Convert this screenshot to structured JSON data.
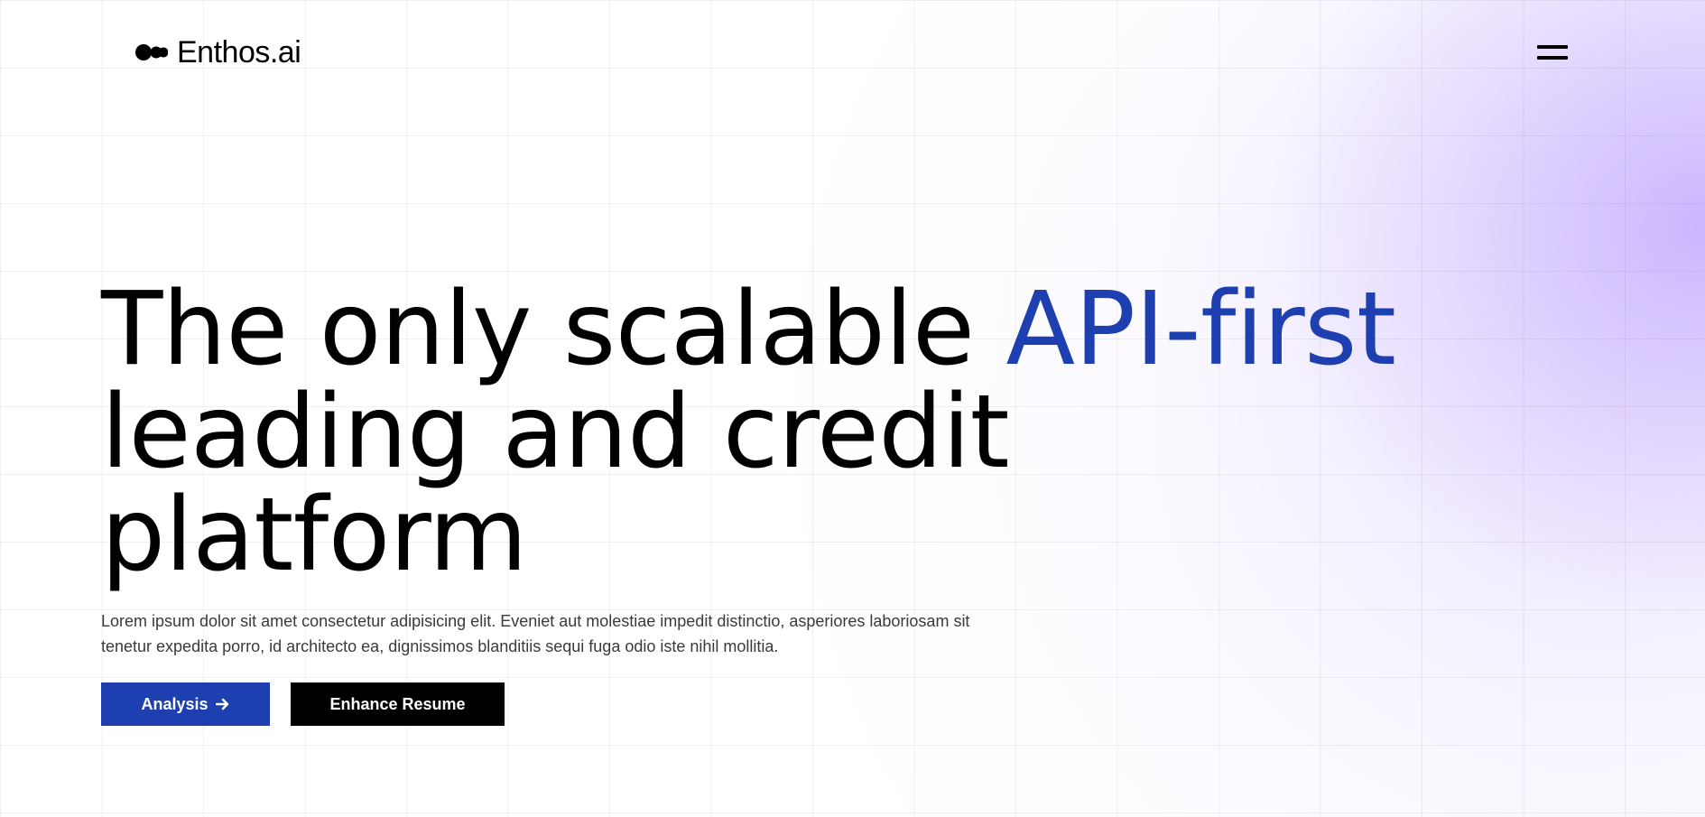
{
  "brand": {
    "name": "Enthos.ai",
    "logo_icon": "two-circles-logo-icon"
  },
  "header": {
    "menu_icon": "hamburger-menu-icon"
  },
  "hero": {
    "title_part1": "The only scalable ",
    "title_accent": "API-first",
    "title_part2": "leading and credit platform",
    "description": "Lorem ipsum dolor sit amet consectetur adipisicing elit. Eveniet aut molestiae impedit distinctio, asperiores laboriosam sit tenetur expedita porro, id architecto ea, dignissimos blanditiis sequi fuga odio iste nihil mollitia.",
    "primary_button": "Analysis",
    "primary_button_icon": "arrow-right-icon",
    "secondary_button": "Enhance Resume"
  },
  "colors": {
    "accent": "#1e3fb0",
    "dark": "#000000",
    "glow": "#d8caff"
  }
}
